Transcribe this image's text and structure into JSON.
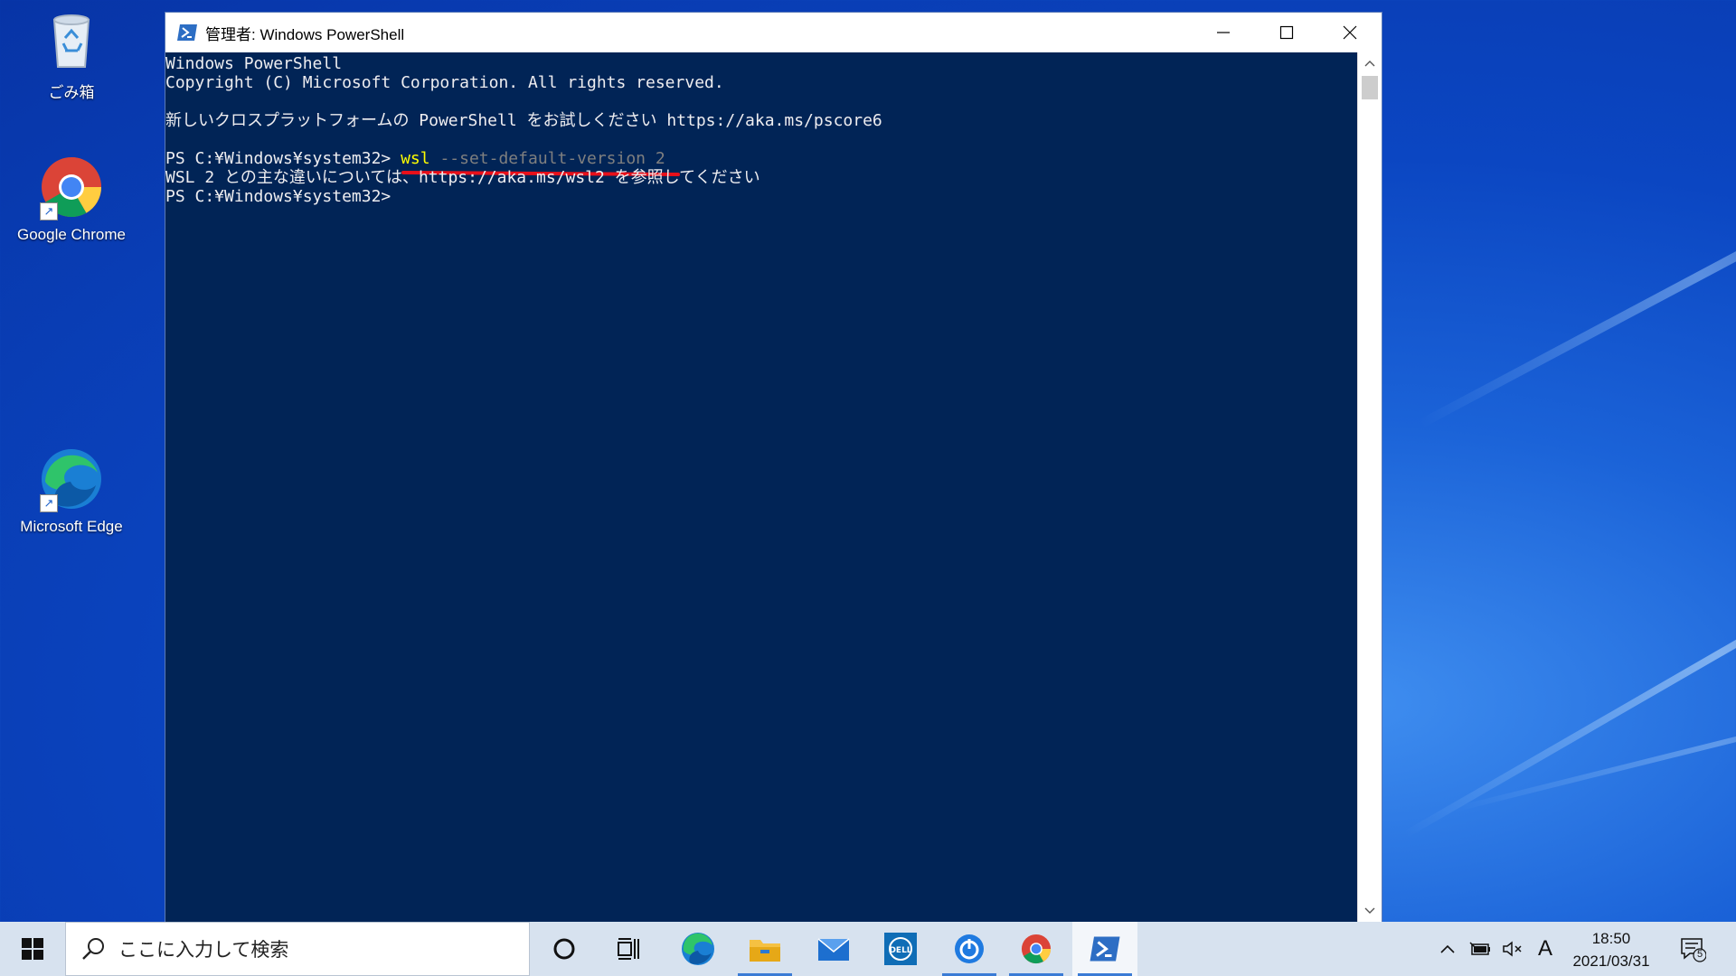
{
  "desktop": {
    "icons": [
      {
        "label": "ごみ箱",
        "icon": "recycle-bin-icon"
      },
      {
        "label": "Google Chrome",
        "icon": "chrome-icon"
      },
      {
        "label": "Microsoft Edge",
        "icon": "edge-icon"
      }
    ]
  },
  "window": {
    "title": "管理者: Windows PowerShell",
    "icon": "powershell-icon",
    "controls": [
      "minimize",
      "maximize",
      "close"
    ]
  },
  "console": {
    "lines": [
      "Windows PowerShell",
      "Copyright (C) Microsoft Corporation. All rights reserved.",
      "",
      "新しいクロスプラットフォームの PowerShell をお試しください https://aka.ms/pscore6",
      "",
      "PS C:¥Windows¥system32> wsl --set-default-version 2",
      "WSL 2 との主な違いについては、https://aka.ms/wsl2 を参照してください",
      "PS C:¥Windows¥system32>"
    ],
    "prompt": "PS C:¥Windows¥system32> ",
    "command_name": "wsl",
    "command_args": " --set-default-version 2",
    "colors": {
      "background": "#012456",
      "text": "#eeedf0",
      "command": "#ffff00",
      "args": "#7f7f7f",
      "highlight_underline": "#e8101a"
    }
  },
  "taskbar": {
    "search_placeholder": "ここに入力して検索",
    "apps": [
      {
        "name": "cortana",
        "icon": "circle-icon"
      },
      {
        "name": "task-view",
        "icon": "task-view-icon"
      },
      {
        "name": "edge",
        "icon": "edge-icon"
      },
      {
        "name": "file-explorer",
        "icon": "folder-icon"
      },
      {
        "name": "mail",
        "icon": "mail-icon"
      },
      {
        "name": "dell",
        "icon": "dell-icon"
      },
      {
        "name": "app-power",
        "icon": "power-app-icon"
      },
      {
        "name": "chrome",
        "icon": "chrome-icon"
      },
      {
        "name": "powershell",
        "icon": "powershell-icon"
      }
    ],
    "tray": {
      "ime": "A",
      "time": "18:50",
      "date": "2021/03/31",
      "notification_count": "5"
    }
  }
}
